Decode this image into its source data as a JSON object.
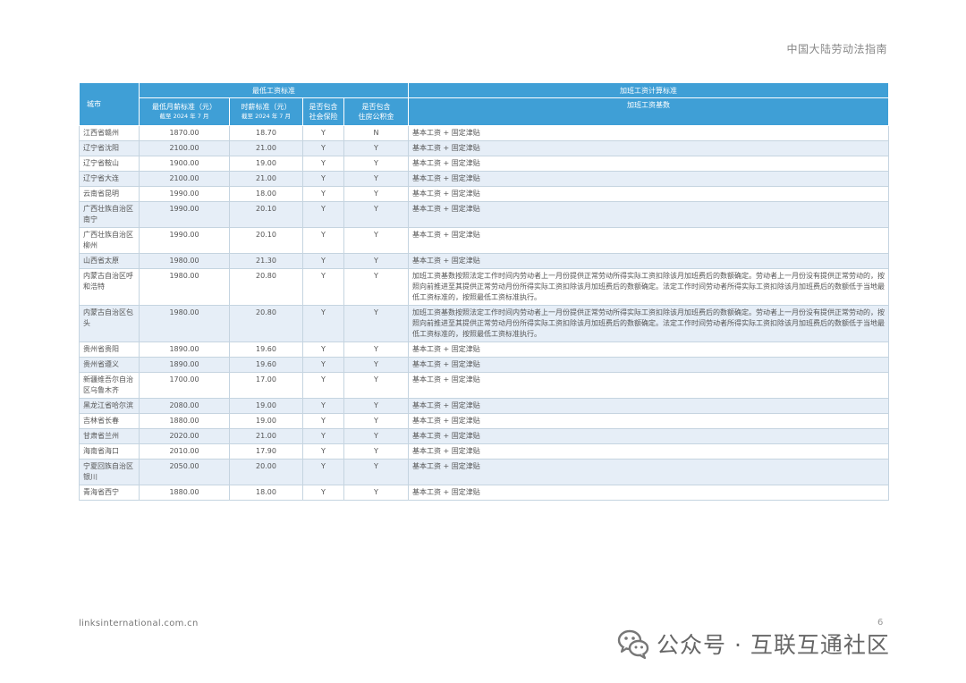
{
  "page": {
    "header_title": "中国大陆劳动法指南",
    "footer_url": "linksinternational.com.cn",
    "page_number": "6"
  },
  "table": {
    "headers": {
      "city": "城市",
      "min_wage_group": "最低工资标准",
      "overtime_group": "加班工资计算标准",
      "monthly_min": "最低月薪标准（元）",
      "monthly_min_note": "截至 2024 年 7 月",
      "hourly_min": "时薪标准（元）",
      "hourly_min_note": "截至 2024 年 7 月",
      "social_insurance_line1": "是否包含",
      "social_insurance_line2": "社会保险",
      "housing_fund_line1": "是否包含",
      "housing_fund_line2": "住房公积金",
      "overtime_base": "加班工资基数"
    },
    "rows": [
      {
        "city": "江西省赣州",
        "monthly": "1870.00",
        "hourly": "18.70",
        "social": "Y",
        "housing": "N",
        "base": "基本工资 + 固定津贴"
      },
      {
        "city": "辽宁省沈阳",
        "monthly": "2100.00",
        "hourly": "21.00",
        "social": "Y",
        "housing": "Y",
        "base": "基本工资 + 固定津贴"
      },
      {
        "city": "辽宁省鞍山",
        "monthly": "1900.00",
        "hourly": "19.00",
        "social": "Y",
        "housing": "Y",
        "base": "基本工资 + 固定津贴"
      },
      {
        "city": "辽宁省大连",
        "monthly": "2100.00",
        "hourly": "21.00",
        "social": "Y",
        "housing": "Y",
        "base": "基本工资 + 固定津贴"
      },
      {
        "city": "云南省昆明",
        "monthly": "1990.00",
        "hourly": "18.00",
        "social": "Y",
        "housing": "Y",
        "base": "基本工资 + 固定津贴"
      },
      {
        "city": "广西壮族自治区南宁",
        "monthly": "1990.00",
        "hourly": "20.10",
        "social": "Y",
        "housing": "Y",
        "base": "基本工资 + 固定津贴"
      },
      {
        "city": "广西壮族自治区柳州",
        "monthly": "1990.00",
        "hourly": "20.10",
        "social": "Y",
        "housing": "Y",
        "base": "基本工资 + 固定津贴"
      },
      {
        "city": "山西省太原",
        "monthly": "1980.00",
        "hourly": "21.30",
        "social": "Y",
        "housing": "Y",
        "base": "基本工资 + 固定津贴"
      },
      {
        "city": "内蒙古自治区呼和浩特",
        "monthly": "1980.00",
        "hourly": "20.80",
        "social": "Y",
        "housing": "Y",
        "base": "加班工资基数按照法定工作时间内劳动者上一月份提供正常劳动所得实际工资扣除该月加班费后的数额确定。劳动者上一月份没有提供正常劳动的，按照向前推进至其提供正常劳动月份所得实际工资扣除该月加班费后的数额确定。法定工作时间劳动者所得实际工资扣除该月加班费后的数额低于当地最低工资标准的，按照最低工资标准执行。"
      },
      {
        "city": "内蒙古自治区包头",
        "monthly": "1980.00",
        "hourly": "20.80",
        "social": "Y",
        "housing": "Y",
        "base": "加班工资基数按照法定工作时间内劳动者上一月份提供正常劳动所得实际工资扣除该月加班费后的数额确定。劳动者上一月份没有提供正常劳动的，按照向前推进至其提供正常劳动月份所得实际工资扣除该月加班费后的数额确定。法定工作时间劳动者所得实际工资扣除该月加班费后的数额低于当地最低工资标准的，按照最低工资标准执行。"
      },
      {
        "city": "贵州省贵阳",
        "monthly": "1890.00",
        "hourly": "19.60",
        "social": "Y",
        "housing": "Y",
        "base": "基本工资 + 固定津贴"
      },
      {
        "city": "贵州省遵义",
        "monthly": "1890.00",
        "hourly": "19.60",
        "social": "Y",
        "housing": "Y",
        "base": "基本工资 + 固定津贴"
      },
      {
        "city": "新疆维吾尔自治区乌鲁木齐",
        "monthly": "1700.00",
        "hourly": "17.00",
        "social": "Y",
        "housing": "Y",
        "base": "基本工资 + 固定津贴"
      },
      {
        "city": "黑龙江省哈尔滨",
        "monthly": "2080.00",
        "hourly": "19.00",
        "social": "Y",
        "housing": "Y",
        "base": "基本工资 + 固定津贴"
      },
      {
        "city": "吉林省长春",
        "monthly": "1880.00",
        "hourly": "19.00",
        "social": "Y",
        "housing": "Y",
        "base": "基本工资 + 固定津贴"
      },
      {
        "city": "甘肃省兰州",
        "monthly": "2020.00",
        "hourly": "21.00",
        "social": "Y",
        "housing": "Y",
        "base": "基本工资 + 固定津贴"
      },
      {
        "city": "海南省海口",
        "monthly": "2010.00",
        "hourly": "17.90",
        "social": "Y",
        "housing": "Y",
        "base": "基本工资 + 固定津贴"
      },
      {
        "city": "宁夏回族自治区银川",
        "monthly": "2050.00",
        "hourly": "20.00",
        "social": "Y",
        "housing": "Y",
        "base": "基本工资 + 固定津贴"
      },
      {
        "city": "青海省西宁",
        "monthly": "1880.00",
        "hourly": "18.00",
        "social": "Y",
        "housing": "Y",
        "base": "基本工资 + 固定津贴"
      }
    ]
  },
  "watermark": {
    "icon": "wechat-icon",
    "text": "公众号 · 互联互通社区"
  }
}
